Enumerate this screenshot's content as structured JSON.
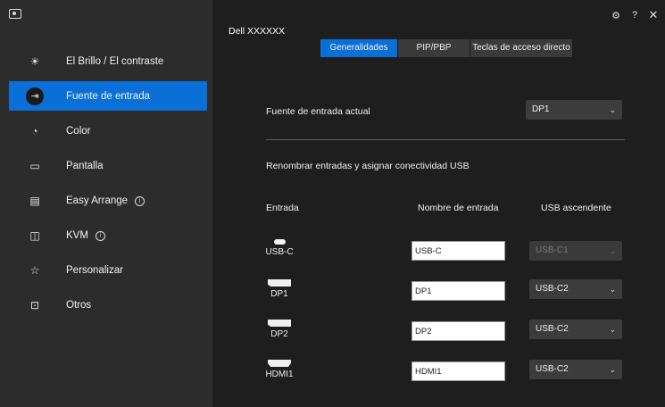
{
  "sidebar": {
    "items": [
      {
        "label": "El Brillo / El contraste",
        "icon": "sun-icon"
      },
      {
        "label": "Fuente de entrada",
        "icon": "input-source-icon"
      },
      {
        "label": "Color",
        "icon": "palette-icon"
      },
      {
        "label": "Pantalla",
        "icon": "monitor-icon"
      },
      {
        "label": "Easy Arrange",
        "icon": "layout-icon"
      },
      {
        "label": "KVM",
        "icon": "kvm-icon"
      },
      {
        "label": "Personalizar",
        "icon": "star-icon"
      },
      {
        "label": "Otros",
        "icon": "others-icon"
      }
    ],
    "active_item": "Fuente de entrada"
  },
  "header": {
    "model": "Dell XXXXXX",
    "tabs": [
      {
        "label": "Generalidades"
      },
      {
        "label": "PIP/PBP"
      },
      {
        "label": "Teclas de acceso directo"
      }
    ],
    "active_tab": "Generalidades"
  },
  "current_input": {
    "label": "Fuente de entrada actual",
    "value": "DP1"
  },
  "rename_section": {
    "title": "Renombrar entradas y asignar conectividad USB",
    "col_input": "Entrada",
    "col_name": "Nombre de entrada",
    "col_usb": "USB ascendente",
    "rows": [
      {
        "port": "USB-C",
        "icon": "usb-c-port-icon",
        "name": "USB-C",
        "usb": "USB-C1",
        "usb_enabled": false
      },
      {
        "port": "DP1",
        "icon": "displayport-icon",
        "name": "DP1",
        "usb": "USB-C2",
        "usb_enabled": true
      },
      {
        "port": "DP2",
        "icon": "displayport-icon",
        "name": "DP2",
        "usb": "USB-C2",
        "usb_enabled": true
      },
      {
        "port": "HDMI1",
        "icon": "hdmi-port-icon",
        "name": "HDMI1",
        "usb": "USB-C2",
        "usb_enabled": true
      }
    ]
  },
  "colors": {
    "accent": "#0a6fd6",
    "sidebar_bg": "#2c2c2c",
    "main_bg": "#1e1e1e"
  }
}
